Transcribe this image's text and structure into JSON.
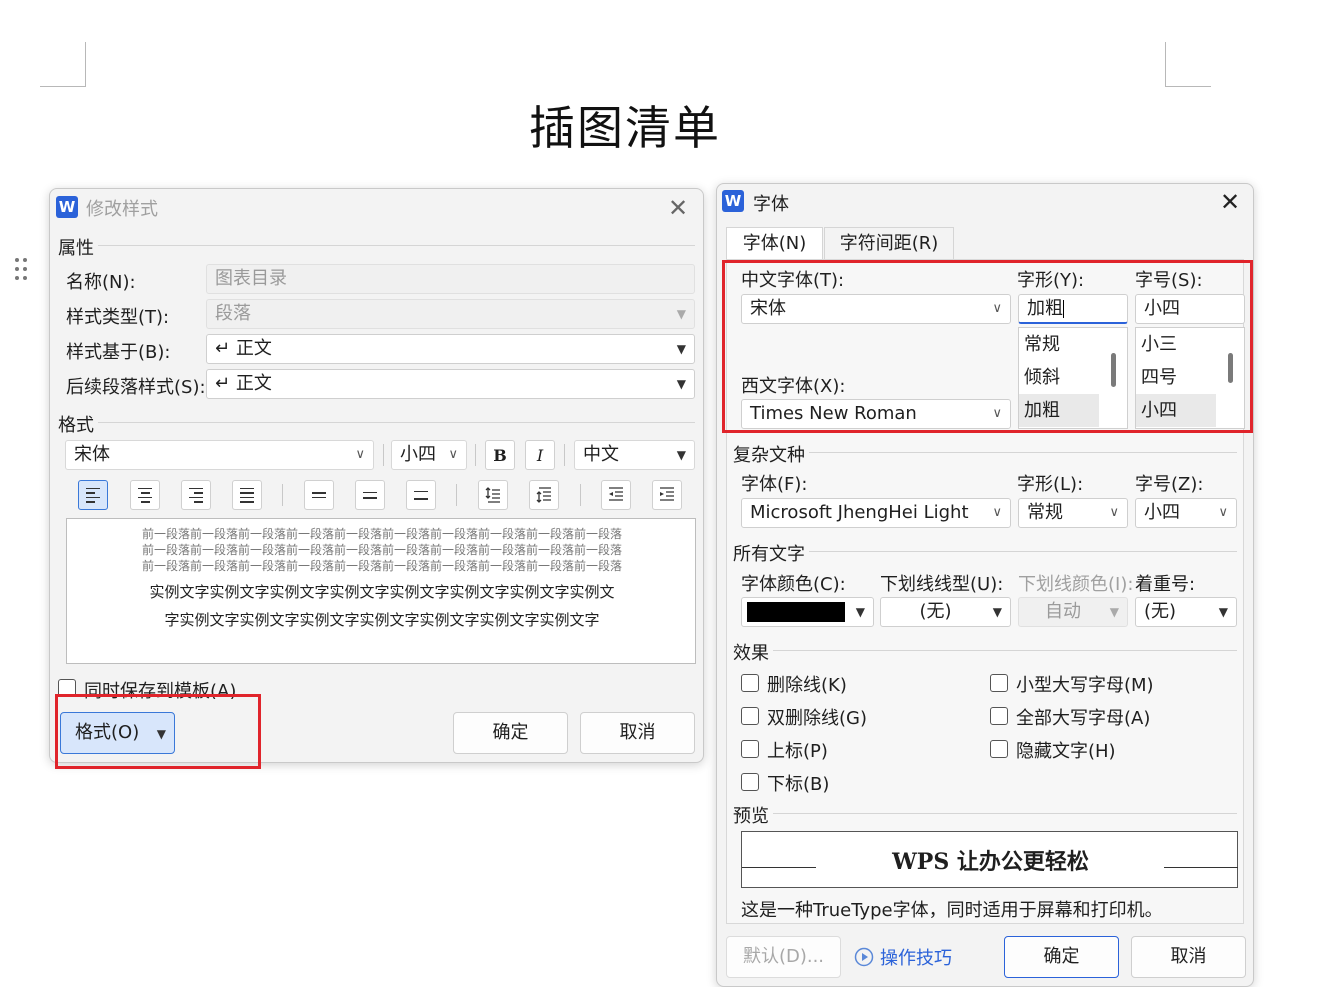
{
  "page": {
    "heading": "插图清单"
  },
  "modify_style": {
    "title": "修改样式",
    "app_icon": "W",
    "properties": {
      "section": "属性",
      "name_label": "名称(N):",
      "name_value": "图表目录",
      "type_label": "样式类型(T):",
      "type_value": "段落",
      "based_on_label": "样式基于(B):",
      "based_on_value": "正文",
      "next_label": "后续段落样式(S):",
      "next_value": "正文",
      "return_glyph": "↵"
    },
    "format": {
      "section": "格式",
      "font": "宋体",
      "size": "小四",
      "bold": "B",
      "italic": "I",
      "script": "中文"
    },
    "preview": {
      "prev_paragraph": "前一段落前一段落前一段落前一段落前一段落前一段落前一段落前一段落前一段落前一段落",
      "sample_line1": "实例文字实例文字实例文字实例文字实例文字实例文字实例文字实例文",
      "sample_line2": "字实例文字实例文字实例文字实例文字实例文字实例文字实例文字"
    },
    "save_template": "同时保存到模板(A)",
    "format_button": "格式(O)",
    "ok": "确定",
    "cancel": "取消"
  },
  "font_dialog": {
    "title": "字体",
    "app_icon": "W",
    "tabs": [
      "字体(N)",
      "字符间距(R)"
    ],
    "cn_font_label": "中文字体(T):",
    "cn_font": "宋体",
    "style_label": "字形(Y):",
    "style_value": "加粗",
    "size_label": "字号(S):",
    "size_value": "小四",
    "style_options": [
      "常规",
      "倾斜",
      "加粗"
    ],
    "size_options": [
      "小三",
      "四号",
      "小四"
    ],
    "west_font_label": "西文字体(X):",
    "west_font": "Times New Roman",
    "complex": {
      "section": "复杂文种",
      "font_label": "字体(F):",
      "font": "Microsoft JhengHei Light",
      "style_label": "字形(L):",
      "style": "常规",
      "size_label": "字号(Z):",
      "size": "小四"
    },
    "all_text": {
      "section": "所有文字",
      "color_label": "字体颜色(C):",
      "color_value": "#000000",
      "underline_label": "下划线线型(U):",
      "underline": "(无)",
      "underline_color_label": "下划线颜色(I):",
      "underline_color": "自动",
      "emphasis_label": "着重号:",
      "emphasis": "(无)"
    },
    "effects": {
      "section": "效果",
      "left": [
        "删除线(K)",
        "双删除线(G)",
        "上标(P)",
        "下标(B)"
      ],
      "right": [
        "小型大写字母(M)",
        "全部大写字母(A)",
        "隐藏文字(H)"
      ]
    },
    "preview": {
      "section": "预览",
      "sample": "WPS 让办公更轻松",
      "note": "这是一种TrueType字体，同时适用于屏幕和打印机。"
    },
    "default_button": "默认(D)...",
    "tips_link": "操作技巧",
    "ok": "确定",
    "cancel": "取消"
  }
}
